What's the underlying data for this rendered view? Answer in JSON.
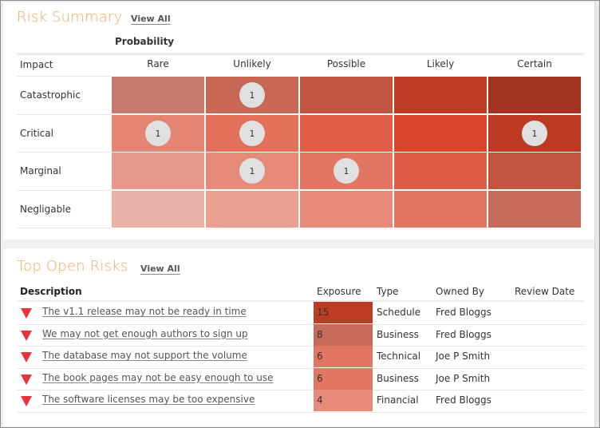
{
  "risk_summary": {
    "title": "Risk Summary",
    "view_all": "View All",
    "probability_label": "Probability",
    "impact_label": "Impact",
    "columns": [
      "Rare",
      "Unlikely",
      "Possible",
      "Likely",
      "Certain"
    ],
    "rows": [
      {
        "label": "Catastrophic",
        "colors": [
          "#c8796b",
          "#c66854",
          "#c25540",
          "#bd3c24",
          "#a3321f"
        ],
        "counts": [
          null,
          "1",
          null,
          null,
          null
        ]
      },
      {
        "label": "Critical",
        "colors": [
          "#e48574",
          "#e2705b",
          "#df5e45",
          "#d9462a",
          "#bd3a22"
        ],
        "counts": [
          "1",
          "1",
          null,
          null,
          "1"
        ]
      },
      {
        "label": "Marginal",
        "colors": [
          "#e79a8b",
          "#e58a78",
          "#e27663",
          "#de5d45",
          "#c25540"
        ],
        "counts": [
          null,
          "1",
          "1",
          null,
          null
        ]
      },
      {
        "label": "Negligable",
        "colors": [
          "#ebb3a8",
          "#ea9f91",
          "#e78a7a",
          "#e27663",
          "#c66b5a"
        ],
        "counts": [
          null,
          null,
          null,
          null,
          null
        ]
      }
    ]
  },
  "top_open_risks": {
    "title": "Top Open Risks",
    "view_all": "View All",
    "headers": {
      "description": "Description",
      "exposure": "Exposure",
      "type": "Type",
      "owned_by": "Owned By",
      "review_date": "Review Date"
    },
    "rows": [
      {
        "description": "The v1.1 release may not be ready in time",
        "exposure": "15",
        "exposure_color": "#bd3c24",
        "type": "Schedule",
        "owner": "Fred Bloggs",
        "review_date": ""
      },
      {
        "description": "We may not get enough authors to sign up",
        "exposure": "8",
        "exposure_color": "#c66b5a",
        "type": "Business",
        "owner": "Fred Bloggs",
        "review_date": ""
      },
      {
        "description": "The database may not support the volume",
        "exposure": "6",
        "exposure_color": "#e27663",
        "type": "Technical",
        "owner": "Joe P Smith",
        "review_date": ""
      },
      {
        "description": "The book pages may not be easy enough to use",
        "exposure": "6",
        "exposure_color": "#e27663",
        "type": "Business",
        "owner": "Joe P Smith",
        "review_date": ""
      },
      {
        "description": "The software licenses may be too expensive",
        "exposure": "4",
        "exposure_color": "#e78a7a",
        "type": "Financial",
        "owner": "Fred Bloggs",
        "review_date": ""
      }
    ],
    "trend_icon_color": "#e8323c"
  },
  "colors": {
    "title_accent": "#f3a95a",
    "badge_bg": "#e0e0e0"
  }
}
